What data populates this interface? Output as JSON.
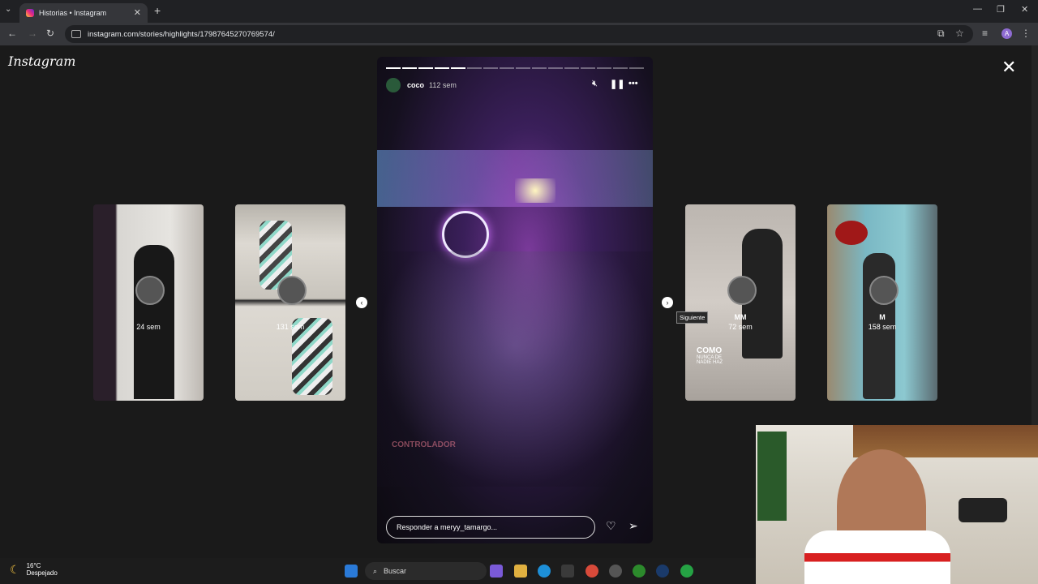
{
  "browser": {
    "tab_title": "Historias • Instagram",
    "url": "instagram.com/stories/highlights/17987645270769574/",
    "new_tab": "+",
    "close_tab": "✕",
    "profile_initial": "A"
  },
  "instagram": {
    "logo": "Instagram",
    "close": "✕"
  },
  "story": {
    "username": "coco",
    "time": "112 sem",
    "reply_placeholder": "Responder a meryy_tamargo...",
    "overlay_text": "CONTROLADOR",
    "progress_total": 16,
    "progress_done": 5
  },
  "thumbs": [
    {
      "name": "",
      "time": "24 sem"
    },
    {
      "name": "",
      "time": "131 sem"
    },
    {
      "name": "MM",
      "time": "72 sem",
      "caption1": "COMO",
      "caption2": "NUNCA DE NADIE HAZ"
    },
    {
      "name": "M",
      "time": "158 sem"
    }
  ],
  "tooltip": "Siguiente",
  "taskbar": {
    "temp": "16°C",
    "weather": "Despejado",
    "search": "Buscar"
  }
}
